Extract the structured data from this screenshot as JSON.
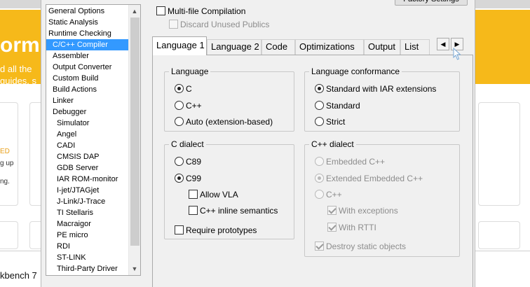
{
  "background_app": {
    "left_heading": "orm",
    "left_subline_1": "d all the",
    "left_subline_2": "guides, s",
    "left_orange_text": "ED",
    "left_text_1": "g up",
    "left_text_2": "ng.",
    "footer_text": "kbench 7"
  },
  "top_options": {
    "multifile_label": "Multi-file Compilation",
    "multifile_checked": false,
    "discard_label": "Discard Unused Publics",
    "discard_checked": false,
    "discard_enabled": false,
    "factory_label": "Factory Settings"
  },
  "category_list": {
    "items": [
      {
        "label": "General Options",
        "level": 0
      },
      {
        "label": "Static Analysis",
        "level": 0
      },
      {
        "label": "Runtime Checking",
        "level": 0
      },
      {
        "label": "C/C++ Compiler",
        "level": 1,
        "selected": true
      },
      {
        "label": "Assembler",
        "level": 1
      },
      {
        "label": "Output Converter",
        "level": 1
      },
      {
        "label": "Custom Build",
        "level": 1
      },
      {
        "label": "Build Actions",
        "level": 1
      },
      {
        "label": "Linker",
        "level": 1
      },
      {
        "label": "Debugger",
        "level": 1
      },
      {
        "label": "Simulator",
        "level": 2
      },
      {
        "label": "Angel",
        "level": 2
      },
      {
        "label": "CADI",
        "level": 2
      },
      {
        "label": "CMSIS DAP",
        "level": 2
      },
      {
        "label": "GDB Server",
        "level": 2
      },
      {
        "label": "IAR ROM-monitor",
        "level": 2
      },
      {
        "label": "I-jet/JTAGjet",
        "level": 2
      },
      {
        "label": "J-Link/J-Trace",
        "level": 2
      },
      {
        "label": "TI Stellaris",
        "level": 2
      },
      {
        "label": "Macraigor",
        "level": 2
      },
      {
        "label": "PE micro",
        "level": 2
      },
      {
        "label": "RDI",
        "level": 2
      },
      {
        "label": "ST-LINK",
        "level": 2
      },
      {
        "label": "Third-Party Driver",
        "level": 2
      }
    ]
  },
  "tabs": {
    "items": [
      "Language 1",
      "Language 2",
      "Code",
      "Optimizations",
      "Output",
      "List"
    ],
    "active": "Language 1"
  },
  "language": {
    "title": "Language",
    "options": [
      "C",
      "C++",
      "Auto (extension-based)"
    ],
    "selected": "C"
  },
  "conformance": {
    "title": "Language conformance",
    "options": [
      "Standard with IAR extensions",
      "Standard",
      "Strict"
    ],
    "selected": "Standard with IAR extensions"
  },
  "c_dialect": {
    "title": "C dialect",
    "options": [
      "C89",
      "C99"
    ],
    "selected": "C99",
    "allow_vla": "Allow VLA",
    "allow_vla_checked": false,
    "inline_semantics": "C++ inline semantics",
    "inline_semantics_checked": false,
    "require_prototypes": "Require prototypes",
    "require_prototypes_checked": false
  },
  "cpp_dialect": {
    "title": "C++ dialect",
    "options": [
      "Embedded C++",
      "Extended Embedded C++",
      "C++"
    ],
    "selected": "Extended Embedded C++",
    "enabled": false,
    "with_exceptions": "With exceptions",
    "with_exceptions_checked": true,
    "with_rtti": "With RTTI",
    "with_rtti_checked": true,
    "destroy_static": "Destroy static objects",
    "destroy_static_checked": true
  },
  "colors": {
    "selection": "#3399ff",
    "dialog_bg": "#f0f0f0",
    "banner": "#f6b91a",
    "disabled_text": "#8d8d8d"
  }
}
